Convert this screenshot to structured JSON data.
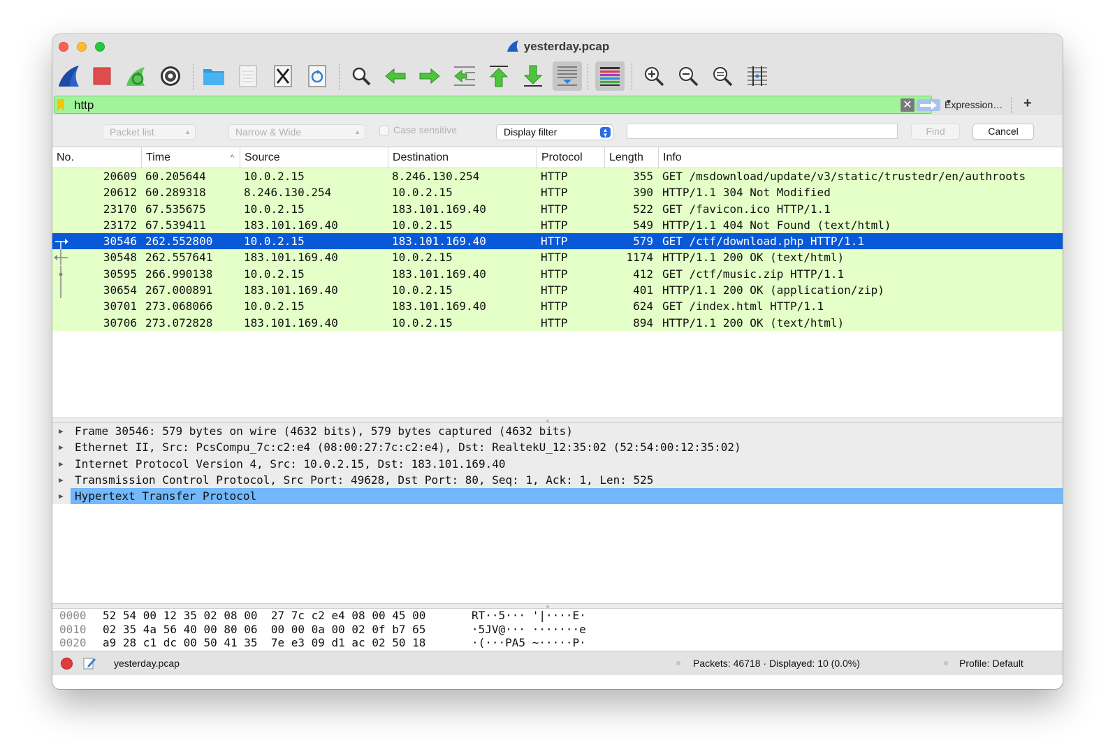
{
  "window": {
    "title": "yesterday.pcap"
  },
  "toolbar": {
    "icons": [
      "shark-fin-icon",
      "stop-icon",
      "restart-icon",
      "options-gear-icon",
      "open-folder-icon",
      "file-icon",
      "close-file-icon",
      "reload-icon",
      "search-icon",
      "back-arrow-icon",
      "forward-arrow-icon",
      "go-to-packet-icon",
      "first-packet-icon",
      "last-packet-icon",
      "autoscroll-icon",
      "colorize-icon",
      "zoom-in-icon",
      "zoom-out-icon",
      "zoom-normal-icon",
      "resize-columns-icon"
    ]
  },
  "filter": {
    "value": "http",
    "expression_label": "Expression…",
    "plus_label": "+",
    "bg_color": "#a0f59a"
  },
  "findbar": {
    "search_in": "Packet list",
    "char_width": "Narrow & Wide",
    "case_sensitive_label": "Case sensitive",
    "search_type": "Display filter",
    "find_label": "Find",
    "cancel_label": "Cancel"
  },
  "packet_list": {
    "columns": [
      "No.",
      "Time",
      "Source",
      "Destination",
      "Protocol",
      "Length",
      "Info"
    ],
    "row_color": "#e4ffc7",
    "selected_color": "#0859d8",
    "rows": [
      {
        "no": "20609",
        "time": "60.205644",
        "src": "10.0.2.15",
        "dst": "8.246.130.254",
        "proto": "HTTP",
        "len": "355",
        "info": "GET /msdownload/update/v3/static/trustedr/en/authroots"
      },
      {
        "no": "20612",
        "time": "60.289318",
        "src": "8.246.130.254",
        "dst": "10.0.2.15",
        "proto": "HTTP",
        "len": "390",
        "info": "HTTP/1.1 304 Not Modified"
      },
      {
        "no": "23170",
        "time": "67.535675",
        "src": "10.0.2.15",
        "dst": "183.101.169.40",
        "proto": "HTTP",
        "len": "522",
        "info": "GET /favicon.ico HTTP/1.1"
      },
      {
        "no": "23172",
        "time": "67.539411",
        "src": "183.101.169.40",
        "dst": "10.0.2.15",
        "proto": "HTTP",
        "len": "549",
        "info": "HTTP/1.1 404 Not Found  (text/html)"
      },
      {
        "no": "30546",
        "time": "262.552800",
        "src": "10.0.2.15",
        "dst": "183.101.169.40",
        "proto": "HTTP",
        "len": "579",
        "info": "GET /ctf/download.php HTTP/1.1"
      },
      {
        "no": "30548",
        "time": "262.557641",
        "src": "183.101.169.40",
        "dst": "10.0.2.15",
        "proto": "HTTP",
        "len": "1174",
        "info": "HTTP/1.1 200 OK  (text/html)"
      },
      {
        "no": "30595",
        "time": "266.990138",
        "src": "10.0.2.15",
        "dst": "183.101.169.40",
        "proto": "HTTP",
        "len": "412",
        "info": "GET /ctf/music.zip HTTP/1.1"
      },
      {
        "no": "30654",
        "time": "267.000891",
        "src": "183.101.169.40",
        "dst": "10.0.2.15",
        "proto": "HTTP",
        "len": "401",
        "info": "HTTP/1.1 200 OK  (application/zip)"
      },
      {
        "no": "30701",
        "time": "273.068066",
        "src": "10.0.2.15",
        "dst": "183.101.169.40",
        "proto": "HTTP",
        "len": "624",
        "info": "GET /index.html HTTP/1.1"
      },
      {
        "no": "30706",
        "time": "273.072828",
        "src": "183.101.169.40",
        "dst": "10.0.2.15",
        "proto": "HTTP",
        "len": "894",
        "info": "HTTP/1.1 200 OK  (text/html)"
      }
    ]
  },
  "details": {
    "rows": [
      "Frame 30546: 579 bytes on wire (4632 bits), 579 bytes captured (4632 bits)",
      "Ethernet II, Src: PcsCompu_7c:c2:e4 (08:00:27:7c:c2:e4), Dst: RealtekU_12:35:02 (52:54:00:12:35:02)",
      "Internet Protocol Version 4, Src: 10.0.2.15, Dst: 183.101.169.40",
      "Transmission Control Protocol, Src Port: 49628, Dst Port: 80, Seq: 1, Ack: 1, Len: 525",
      "Hypertext Transfer Protocol"
    ],
    "highlight_color": "#72b8fb"
  },
  "bytes": {
    "rows": [
      {
        "offset": "0000",
        "hex": "52 54 00 12 35 02 08 00  27 7c c2 e4 08 00 45 00",
        "ascii": "RT··5··· '|····E·"
      },
      {
        "offset": "0010",
        "hex": "02 35 4a 56 40 00 80 06  00 00 0a 00 02 0f b7 65",
        "ascii": "·5JV@··· ·······e"
      },
      {
        "offset": "0020",
        "hex": "a9 28 c1 dc 00 50 41 35  7e e3 09 d1 ac 02 50 18",
        "ascii": "·(···PA5 ~·····P·"
      }
    ]
  },
  "status": {
    "file": "yesterday.pcap",
    "packets": "Packets: 46718 · Displayed: 10 (0.0%)",
    "profile": "Profile: Default"
  }
}
